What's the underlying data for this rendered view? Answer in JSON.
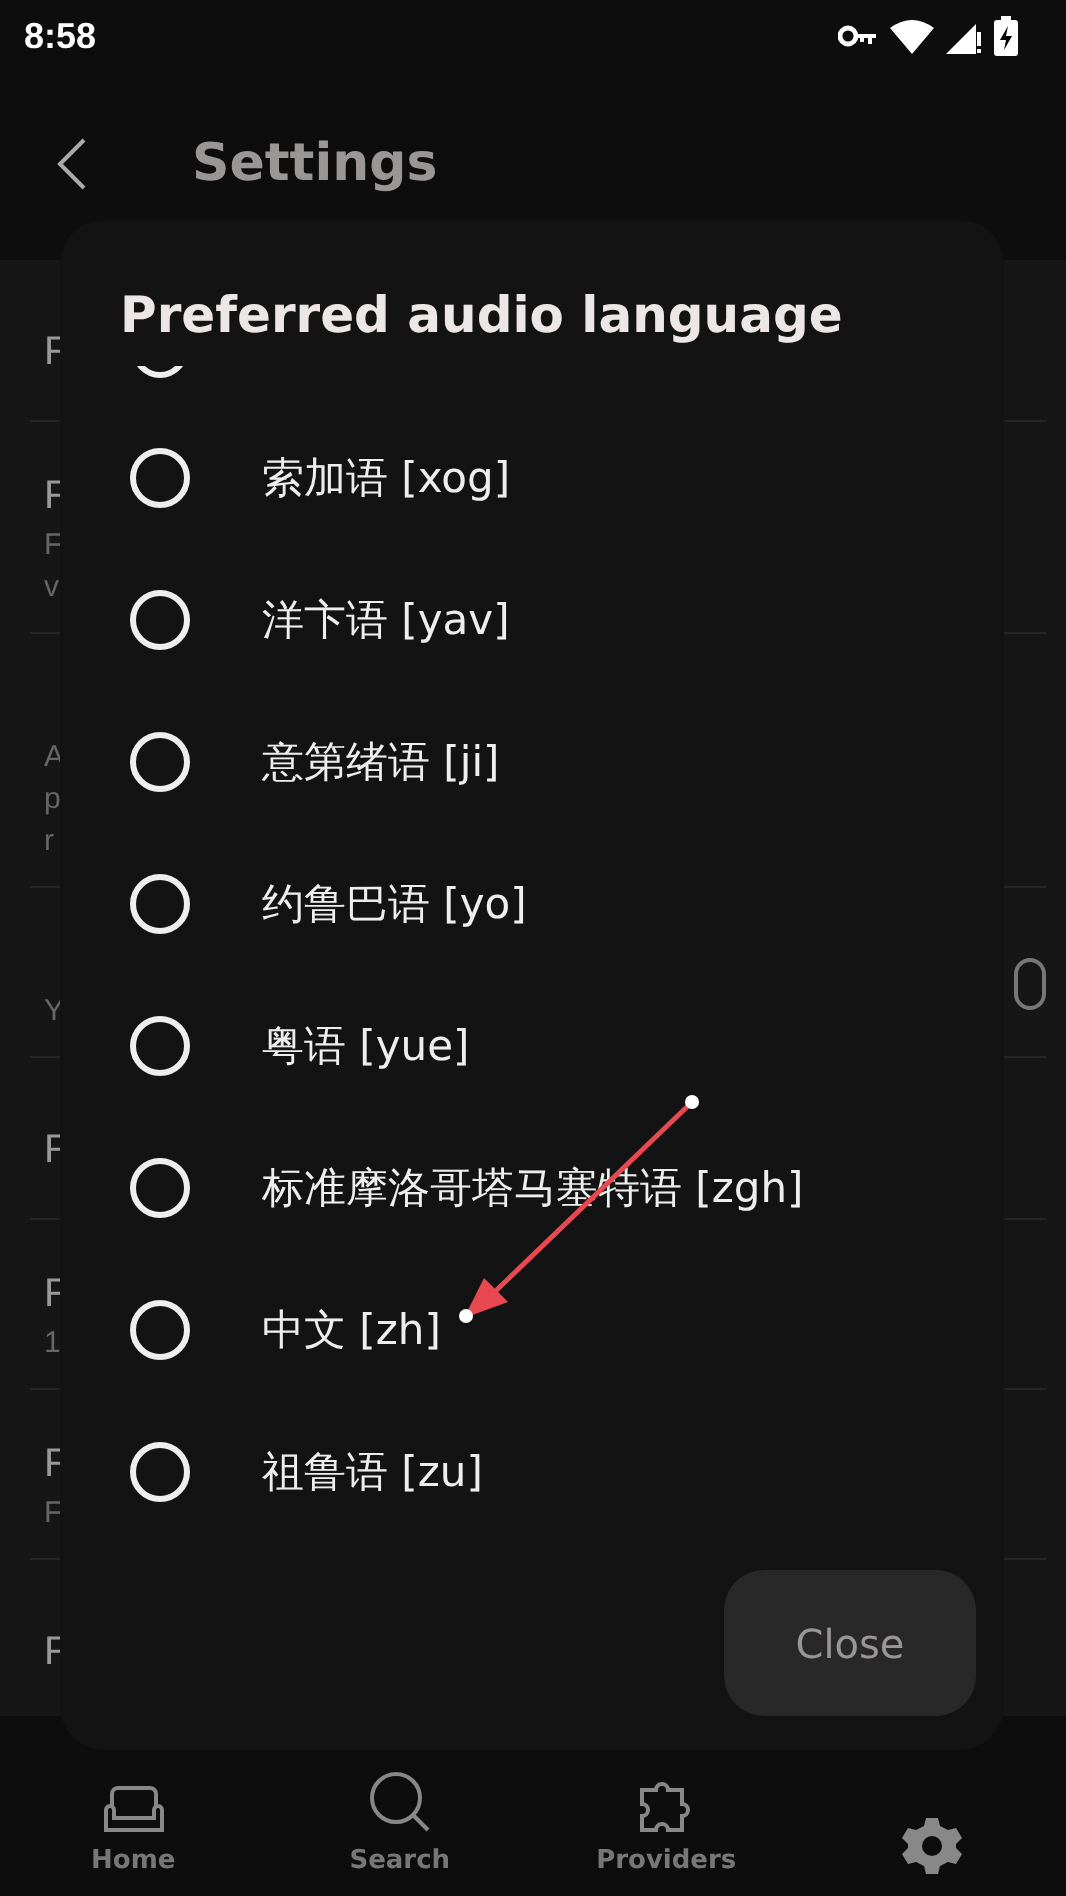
{
  "status_bar": {
    "time": "8:58"
  },
  "app_bar": {
    "title": "Settings"
  },
  "background_rows": [
    {
      "title": "F"
    },
    {
      "title": "F",
      "lines": [
        "F",
        "v"
      ]
    },
    {
      "lines": [
        "A",
        "p",
        "r"
      ]
    },
    {
      "lines": [
        "Y"
      ],
      "toggle": true
    },
    {
      "title": "F"
    },
    {
      "title": "F",
      "lines": [
        "1"
      ]
    },
    {
      "title": "F",
      "lines": [
        "F"
      ]
    },
    {
      "title": "F"
    }
  ],
  "dialog": {
    "title": "Preferred audio language",
    "partial_option": {
      "selected": false
    },
    "options": [
      {
        "label": "索加语 [xog]",
        "selected": false
      },
      {
        "label": "洋卞语 [yav]",
        "selected": false
      },
      {
        "label": "意第绪语 [ji]",
        "selected": false
      },
      {
        "label": "约鲁巴语 [yo]",
        "selected": false
      },
      {
        "label": "粤语 [yue]",
        "selected": false
      },
      {
        "label": "标准摩洛哥塔马塞特语 [zgh]",
        "selected": false
      },
      {
        "label": "中文 [zh]",
        "selected": false
      },
      {
        "label": "祖鲁语 [zu]",
        "selected": false
      }
    ],
    "close_button": "Close"
  },
  "bottom_nav": [
    {
      "kind": "home",
      "label": "Home"
    },
    {
      "kind": "search",
      "label": "Search"
    },
    {
      "kind": "providers",
      "label": "Providers"
    },
    {
      "kind": "settings"
    }
  ]
}
